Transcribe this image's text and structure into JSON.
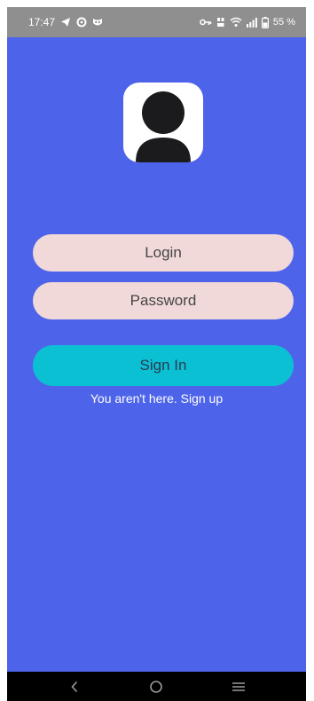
{
  "status_bar": {
    "time": "17:47",
    "battery": "55 %",
    "icons": [
      "telegram-icon",
      "ring-icon",
      "owl-icon",
      "key-icon",
      "volte-icon",
      "wifi-icon",
      "signal-icon",
      "battery-icon"
    ]
  },
  "login_form": {
    "login_placeholder": "Login",
    "password_placeholder": "Password",
    "sign_in_label": "Sign In",
    "signup_text": "You aren't here. Sign up"
  },
  "nav_bar": {
    "icons": [
      "back-icon",
      "home-icon",
      "recents-icon"
    ]
  },
  "colors": {
    "background": "#4d64ea",
    "status_bar": "#8f8f8f",
    "input_bg": "#f1d9d9",
    "button_bg": "#0cc0d3",
    "nav_bar": "#000000"
  }
}
